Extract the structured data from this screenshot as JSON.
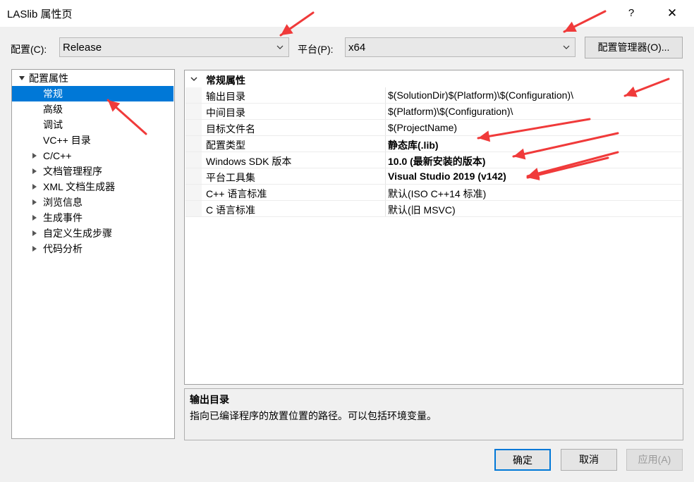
{
  "window": {
    "title": "LASlib 属性页",
    "help_label": "?",
    "close_label": "✕"
  },
  "config_bar": {
    "config_label": "配置(C):",
    "config_value": "Release",
    "platform_label": "平台(P):",
    "platform_value": "x64",
    "manager_button": "配置管理器(O)..."
  },
  "tree": {
    "root": "配置属性",
    "items": [
      {
        "label": "常规",
        "selected": true,
        "expandable": false
      },
      {
        "label": "高级",
        "selected": false,
        "expandable": false
      },
      {
        "label": "调试",
        "selected": false,
        "expandable": false
      },
      {
        "label": "VC++ 目录",
        "selected": false,
        "expandable": false
      },
      {
        "label": "C/C++",
        "selected": false,
        "expandable": true
      },
      {
        "label": "文档管理程序",
        "selected": false,
        "expandable": true
      },
      {
        "label": "XML 文档生成器",
        "selected": false,
        "expandable": true
      },
      {
        "label": "浏览信息",
        "selected": false,
        "expandable": true
      },
      {
        "label": "生成事件",
        "selected": false,
        "expandable": true
      },
      {
        "label": "自定义生成步骤",
        "selected": false,
        "expandable": true
      },
      {
        "label": "代码分析",
        "selected": false,
        "expandable": true
      }
    ]
  },
  "grid": {
    "section": "常规属性",
    "rows": [
      {
        "name": "输出目录",
        "value": "$(SolutionDir)$(Platform)\\$(Configuration)\\",
        "bold": false
      },
      {
        "name": "中间目录",
        "value": "$(Platform)\\$(Configuration)\\",
        "bold": false
      },
      {
        "name": "目标文件名",
        "value": "$(ProjectName)",
        "bold": false
      },
      {
        "name": "配置类型",
        "value": "静态库(.lib)",
        "bold": true
      },
      {
        "name": "Windows SDK 版本",
        "value": "10.0 (最新安装的版本)",
        "bold": true
      },
      {
        "name": "平台工具集",
        "value": "Visual Studio 2019 (v142)",
        "bold": true
      },
      {
        "name": "C++ 语言标准",
        "value": "默认(ISO C++14 标准)",
        "bold": false
      },
      {
        "name": "C 语言标准",
        "value": "默认(旧 MSVC)",
        "bold": false
      }
    ]
  },
  "description": {
    "title": "输出目录",
    "text": "指向已编译程序的放置位置的路径。可以包括环境变量。"
  },
  "buttons": {
    "ok": "确定",
    "cancel": "取消",
    "apply": "应用(A)"
  },
  "colors": {
    "selection": "#0078d7",
    "annotation_arrow": "#f03a3a",
    "dialog_bg": "#f0f0f0"
  }
}
